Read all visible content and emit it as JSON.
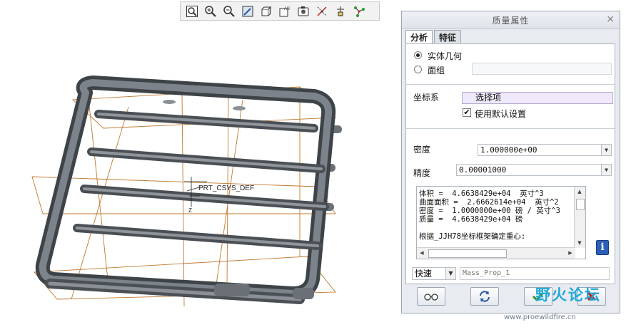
{
  "model": {
    "csys_label": "PRT_CSYS_DEF",
    "axis_z": "Z"
  },
  "toolbar": {
    "buttons": [
      {
        "name": "zoom-fit-icon"
      },
      {
        "name": "zoom-in-icon"
      },
      {
        "name": "zoom-out-icon"
      },
      {
        "name": "repaint-icon"
      },
      {
        "name": "display-style-icon"
      },
      {
        "name": "saved-views-icon"
      },
      {
        "name": "view-manager-icon"
      },
      {
        "name": "datum-display-icon"
      },
      {
        "name": "annotation-display-icon"
      },
      {
        "name": "spin-center-icon"
      }
    ]
  },
  "dialog": {
    "title": "质量属性",
    "tabs": [
      "分析",
      "特征"
    ],
    "radio_solid": "实体几何",
    "radio_quilt": "面组",
    "csys_label": "坐标系",
    "csys_select": "选择项",
    "use_default": "使用默认设置",
    "density_label": "密度",
    "density_value": "1.000000e+00",
    "accuracy_label": "精度",
    "accuracy_value": "0.00001000",
    "results": [
      "体积 =  4.6638429e+04  英寸^3",
      "曲面面积 =  2.6662614e+04  英寸^2",
      "密度 =  1.0000000e+00 磅 / 英寸^3",
      "质量 =  4.6638429e+04 磅",
      "",
      "根据_JJH78坐标框架确定重心:"
    ],
    "quick_label": "快速",
    "name_value": "Mass_Prop_1"
  },
  "watermark": {
    "brand": "野火论坛",
    "url": "www.proewildfire.cn"
  },
  "colors": {
    "model_gray": "#5e6369",
    "datum_orange": "#c0782e",
    "dialog_bg": "#e8ebef",
    "select_bg": "#efe9fb",
    "info_blue": "#2c5fb5",
    "ok_green": "#2a9a2a",
    "cancel_red": "#c8201c"
  }
}
